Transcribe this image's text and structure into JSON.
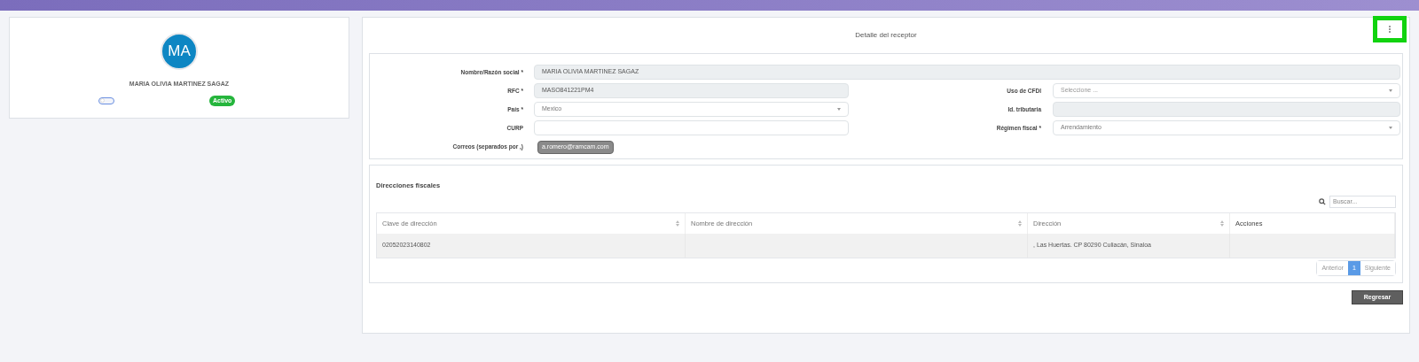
{
  "profile": {
    "initials": "MA",
    "name": "MARIA OLIVIA MARTINEZ SAGAZ",
    "toggle_on": false,
    "status": "Activo"
  },
  "panel": {
    "title": "Detalle del receptor"
  },
  "form": {
    "name": {
      "label": "Nombre/Razón social *",
      "value": "MARIA OLIVIA MARTINEZ SAGAZ"
    },
    "left": [
      {
        "kind": "readonly",
        "label": "RFC *",
        "value": "MASO841221PM4"
      },
      {
        "kind": "select",
        "label": "País *",
        "value": "Mexico"
      },
      {
        "kind": "text",
        "label": "CURP"
      }
    ],
    "right": [
      {
        "kind": "select",
        "label": "Uso de CFDI",
        "placeholder": "Seleccione ..."
      },
      {
        "kind": "readonly",
        "label": "Id. tributaria"
      },
      {
        "kind": "select",
        "label": "Régimen fiscal *",
        "value": "Arrendamiento"
      }
    ],
    "emails": {
      "label": "Correos (separados por ,)",
      "chips": [
        "a.romero@ramcam.com"
      ]
    }
  },
  "addresses": {
    "title": "Direcciones fiscales",
    "search_placeholder": "Buscar...",
    "columns": [
      {
        "label": "Clave de dirección",
        "sortable": true
      },
      {
        "label": "Nombre de dirección",
        "sortable": true
      },
      {
        "label": "Dirección",
        "sortable": true
      },
      {
        "label": "Acciones",
        "sortable": false
      }
    ],
    "rows": [
      [
        "02052023140802",
        "",
        ", Las Huertas. CP 80290 Culiacán, Sinaloa",
        ""
      ]
    ],
    "pagination": [
      {
        "label": "Anterior",
        "selected": false
      },
      {
        "label": "1",
        "selected": true
      },
      {
        "label": "Siguiente",
        "selected": false
      }
    ]
  },
  "back_button": "Regresar"
}
